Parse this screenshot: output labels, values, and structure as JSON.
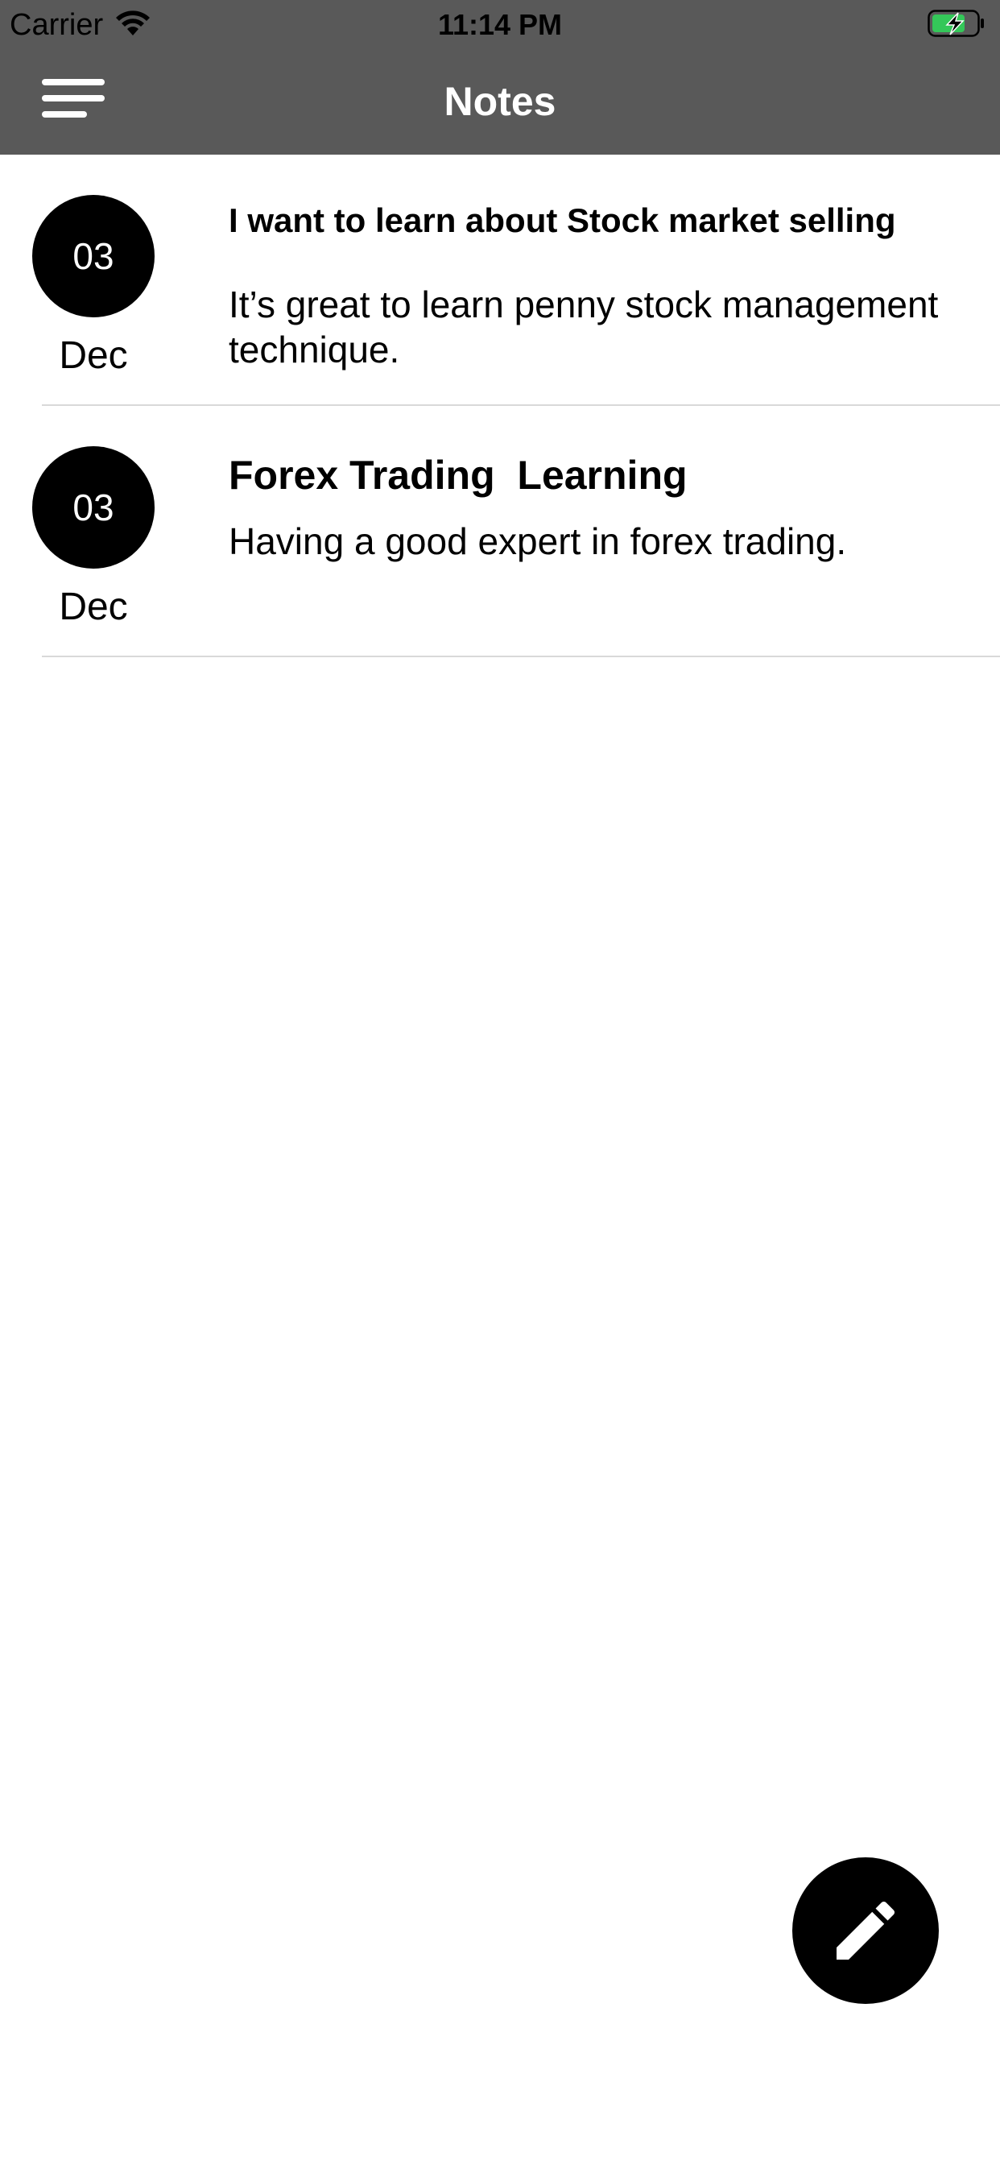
{
  "status_bar": {
    "carrier": "Carrier",
    "time": "11:14 PM",
    "battery_color": "#34c759"
  },
  "nav": {
    "title": "Notes",
    "menu_icon": "hamburger-menu-icon",
    "background": "#595959"
  },
  "notes": [
    {
      "day": "03",
      "month": "Dec",
      "title": "I want to learn about Stock market selling",
      "body": "It’s great to learn penny stock management technique."
    },
    {
      "day": "03",
      "month": "Dec",
      "title": "Forex Trading  Learning",
      "body": "Having a good expert in forex trading."
    }
  ],
  "fab": {
    "icon": "pencil-icon"
  }
}
